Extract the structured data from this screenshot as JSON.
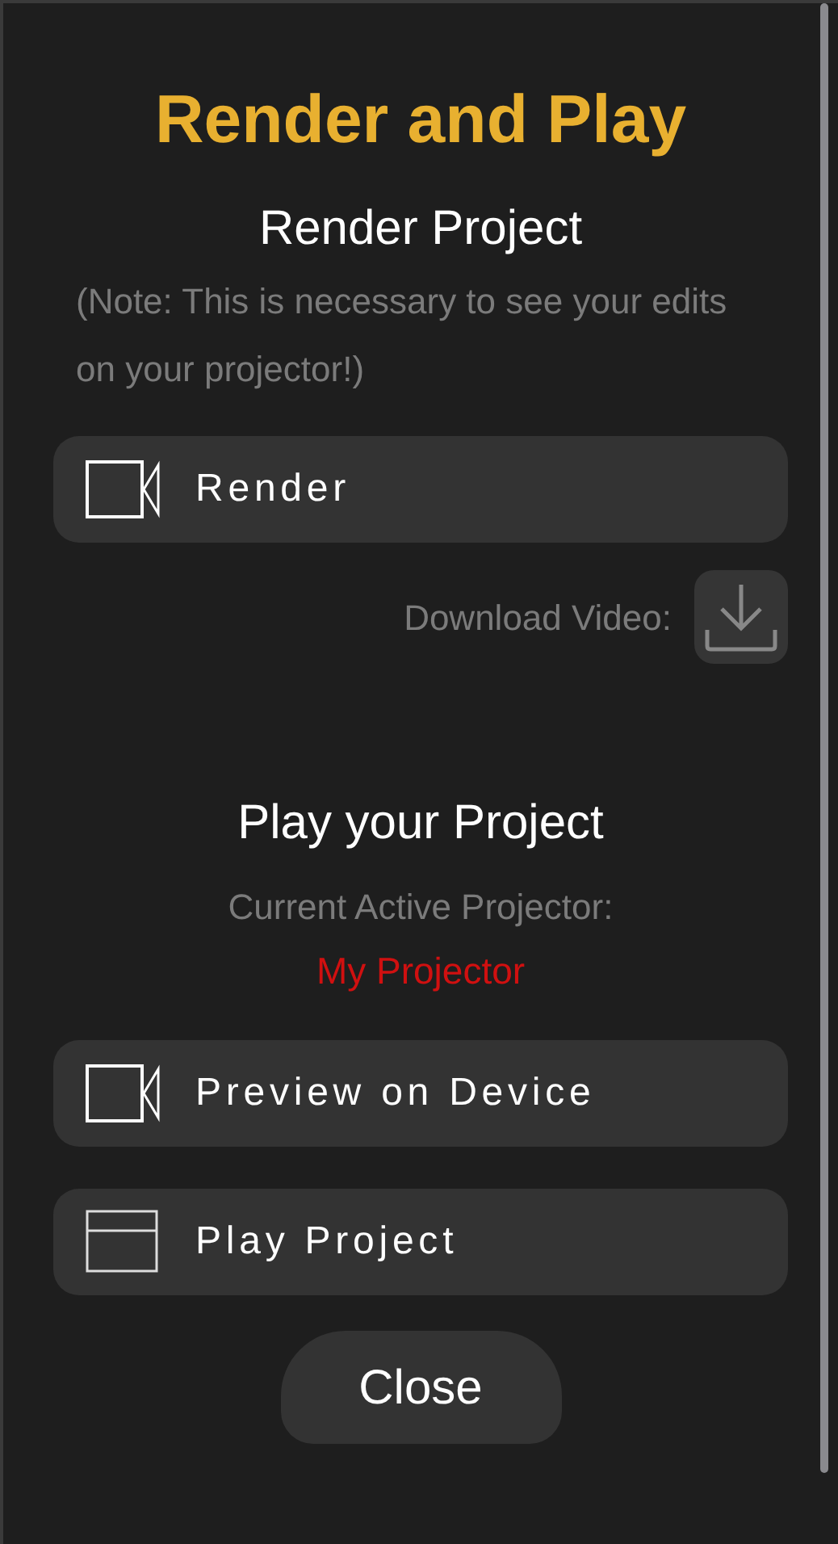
{
  "title": "Render and Play",
  "render_section": {
    "heading": "Render Project",
    "note": "(Note: This is necessary to see your edits on your projector!)",
    "button": {
      "label": "Render",
      "kind": "camera"
    },
    "download_label": "Download Video:"
  },
  "play_section": {
    "heading": "Play your Project",
    "projector_label": "Current Active Projector:",
    "projector_name": "My Projector",
    "buttons": [
      {
        "label": "Preview on Device",
        "kind": "camera"
      },
      {
        "label": "Play Project",
        "kind": "window"
      }
    ]
  },
  "close_button": "Close"
}
